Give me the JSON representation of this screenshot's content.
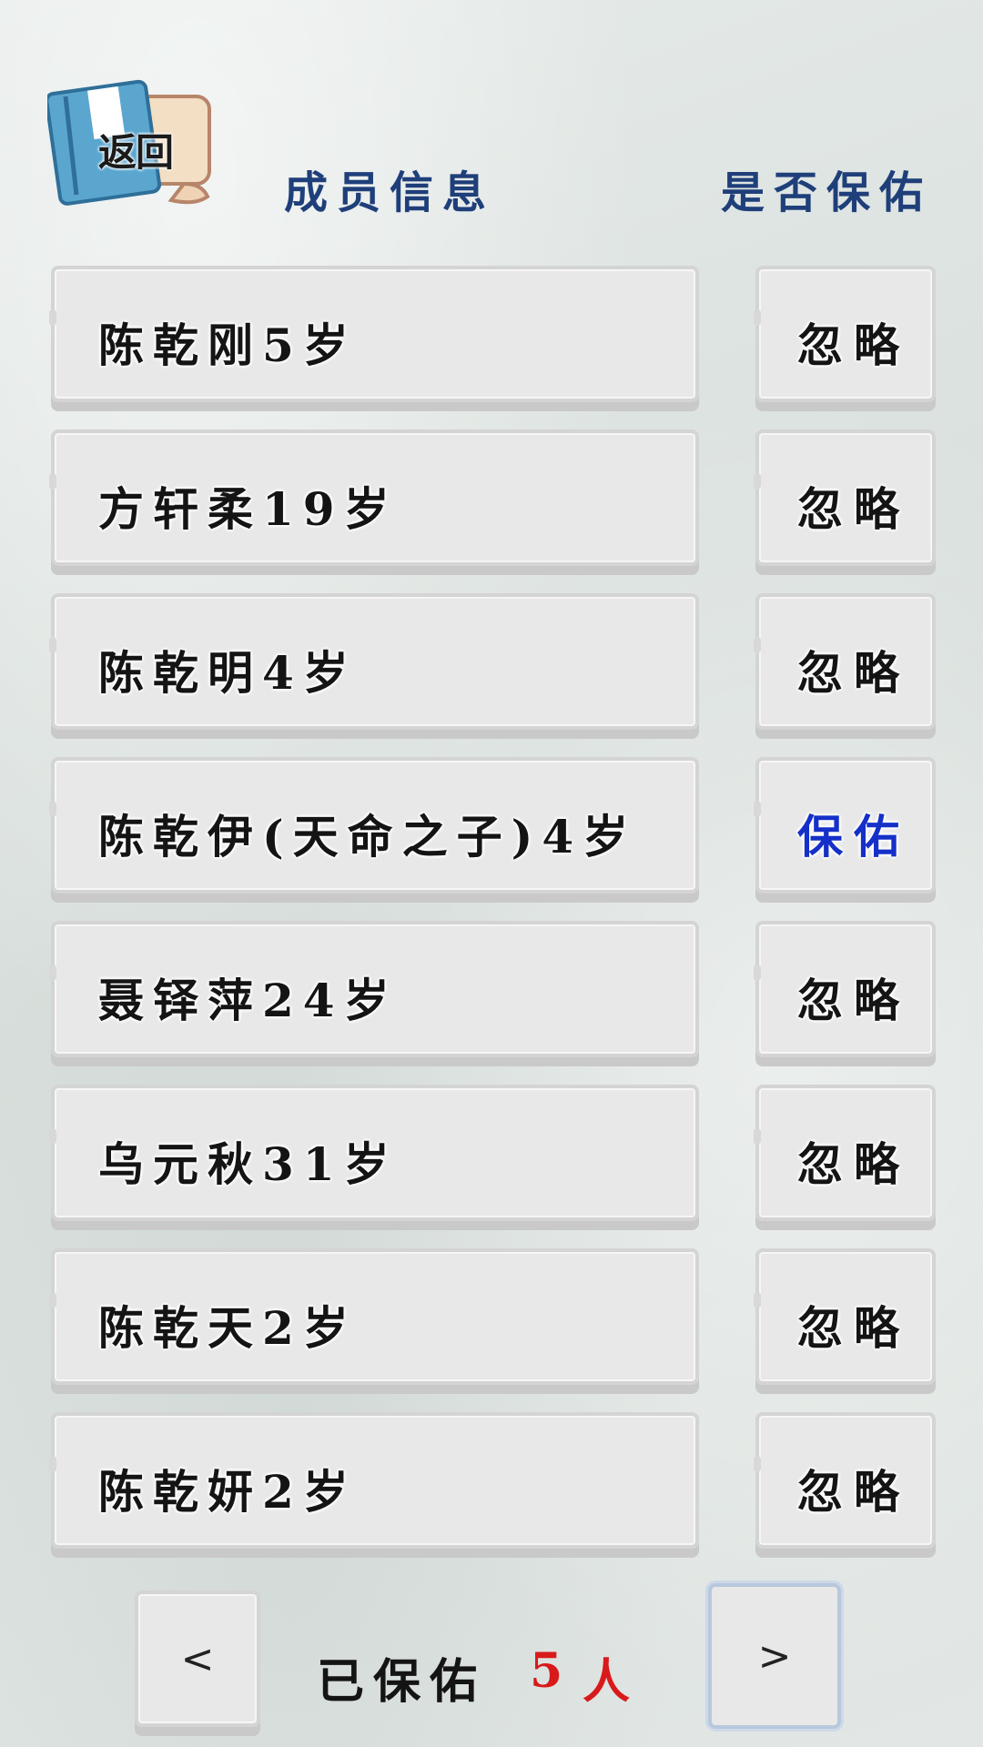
{
  "header": {
    "back_label": "返回",
    "member_info": "成员信息",
    "protect_question": "是否保佑"
  },
  "members": [
    {
      "name": "陈乾刚5岁",
      "status": "忽略"
    },
    {
      "name": "方轩柔19岁",
      "status": "忽略"
    },
    {
      "name": "陈乾明4岁",
      "status": "忽略"
    },
    {
      "name": "陈乾伊(天命之子)4岁",
      "status": "保佑"
    },
    {
      "name": "聂铎萍24岁",
      "status": "忽略"
    },
    {
      "name": "乌元秋31岁",
      "status": "忽略"
    },
    {
      "name": "陈乾天2岁",
      "status": "忽略"
    },
    {
      "name": "陈乾妍2岁",
      "status": "忽略"
    }
  ],
  "footer": {
    "prev_label": "<",
    "next_label": ">",
    "protected_label": "已保佑",
    "protected_count": "5",
    "unit": "人"
  },
  "colors": {
    "header_text": "#1f3f7a",
    "active_status": "#1530c8",
    "count": "#d91a1a"
  }
}
